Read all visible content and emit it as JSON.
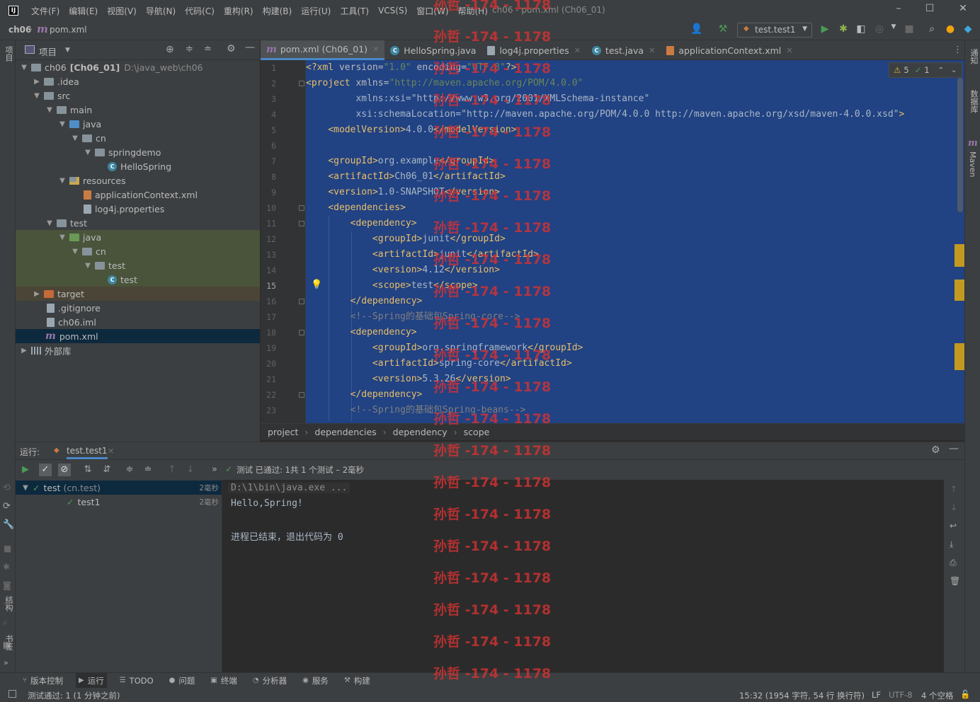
{
  "menubar": {
    "items": [
      "文件(F)",
      "编辑(E)",
      "视图(V)",
      "导航(N)",
      "代码(C)",
      "重构(R)",
      "构建(B)",
      "运行(U)",
      "工具(T)",
      "VCS(S)",
      "窗口(W)",
      "帮助(H)"
    ],
    "window_title": "ch06 - pom.xml (Ch06_01)"
  },
  "navbar": {
    "project": "ch06",
    "file": "pom.xml",
    "run_config": "test.test1"
  },
  "left_strip": {
    "project": "项目",
    "structure": "结构",
    "bookmarks": "书签"
  },
  "right_strip": {
    "notifications": "通知",
    "database": "数据库",
    "maven": "Maven"
  },
  "project_panel": {
    "title": "项目",
    "tree": [
      {
        "label": "ch06",
        "bold": "[Ch06_01]",
        "path": "D:\\java_web\\ch06"
      },
      {
        "label": ".idea"
      },
      {
        "label": "src"
      },
      {
        "label": "main"
      },
      {
        "label": "java"
      },
      {
        "label": "cn"
      },
      {
        "label": "springdemo"
      },
      {
        "label": "HelloSpring"
      },
      {
        "label": "resources"
      },
      {
        "label": "applicationContext.xml"
      },
      {
        "label": "log4j.properties"
      },
      {
        "label": "test"
      },
      {
        "label": "java"
      },
      {
        "label": "cn"
      },
      {
        "label": "test"
      },
      {
        "label": "test"
      },
      {
        "label": "target"
      },
      {
        "label": ".gitignore"
      },
      {
        "label": "ch06.iml"
      },
      {
        "label": "pom.xml"
      },
      {
        "label": "外部库"
      }
    ]
  },
  "editor": {
    "tabs": [
      {
        "label": "pom.xml (Ch06_01)",
        "active": true
      },
      {
        "label": "HelloSpring.java"
      },
      {
        "label": "log4j.properties"
      },
      {
        "label": "test.java"
      },
      {
        "label": "applicationContext.xml"
      }
    ],
    "warnings": "5",
    "ok": "1",
    "line_numbers": [
      "1",
      "2",
      "3",
      "4",
      "5",
      "6",
      "7",
      "8",
      "9",
      "10",
      "11",
      "12",
      "13",
      "14",
      "15",
      "16",
      "17",
      "18",
      "19",
      "20",
      "21",
      "22",
      "23"
    ],
    "lines": [
      "<?xml version=\"1.0\" encoding=\"UTF-8\"?>",
      "<project xmlns=\"http://maven.apache.org/POM/4.0.0\"",
      "         xmlns:xsi=\"http://www.w3.org/2001/XMLSchema-instance\"",
      "         xsi:schemaLocation=\"http://maven.apache.org/POM/4.0.0 http://maven.apache.org/xsd/maven-4.0.0.xsd\">",
      "    <modelVersion>4.0.0</modelVersion>",
      "",
      "    <groupId>org.example</groupId>",
      "    <artifactId>Ch06_01</artifactId>",
      "    <version>1.0-SNAPSHOT</version>",
      "    <dependencies>",
      "        <dependency>",
      "            <groupId>junit</groupId>",
      "            <artifactId>junit</artifactId>",
      "            <version>4.12</version>",
      "            <scope>test</scope>",
      "        </dependency>",
      "        <!--Spring的基础包Spring-core-->",
      "        <dependency>",
      "            <groupId>org.springframework</groupId>",
      "            <artifactId>spring-core</artifactId>",
      "            <version>5.3.26</version>",
      "        </dependency>",
      "        <!--Spring的基础包Spring-beans-->"
    ],
    "breadcrumb": [
      "project",
      "dependencies",
      "dependency",
      "scope"
    ]
  },
  "run_panel": {
    "label": "运行:",
    "tab": "test.test1",
    "status": "测试 已通过: 1共 1 个测试 – 2毫秒",
    "tree": [
      {
        "name": "test",
        "pkg": "(cn.test)",
        "time": "2毫秒"
      },
      {
        "name": "test1",
        "time": "2毫秒"
      }
    ],
    "console": [
      "D:\\1\\bin\\java.exe ...",
      "Hello,Spring!",
      "",
      "进程已结束，退出代码为 0"
    ]
  },
  "bottom_tools": [
    "版本控制",
    "运行",
    "TODO",
    "问题",
    "终端",
    "分析器",
    "服务",
    "构建"
  ],
  "statusbar": {
    "message": "测试通过: 1 (1 分钟之前)",
    "position": "15:32 (1954 字符, 54 行 换行符)",
    "line_sep": "LF",
    "encoding": "UTF-8",
    "indent": "4 个空格"
  },
  "watermark": "孙哲 -174 - 1178",
  "colors": {
    "selection": "#214283",
    "accent": "#4a88c7",
    "pass": "#499c54",
    "warning": "#e3b341"
  }
}
